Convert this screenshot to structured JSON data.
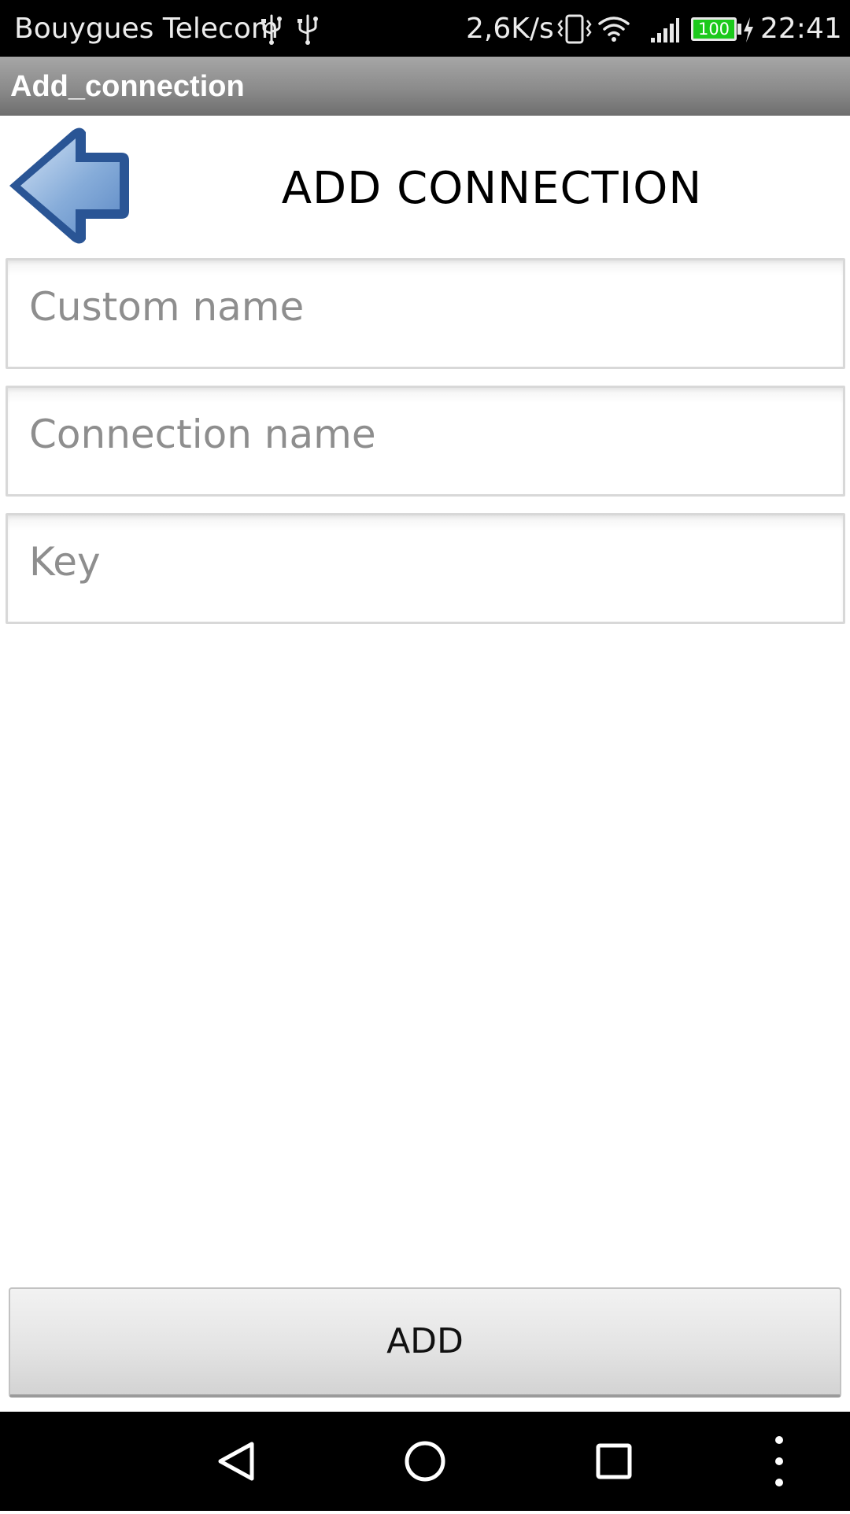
{
  "status_bar": {
    "carrier": "Bouygues Telecom",
    "net_speed": "2,6K/s",
    "battery_level": "100",
    "time": "22:41",
    "icons": [
      "usb-icon",
      "usb-icon",
      "vibrate-icon",
      "wifi-icon",
      "signal-icon",
      "battery-icon",
      "charging-icon"
    ],
    "battery_color": "#1bc91b"
  },
  "app_bar": {
    "title": "Add_connection"
  },
  "header": {
    "back_icon": "arrow-left-icon",
    "heading": "ADD CONNECTION",
    "back_color": "#2a5595"
  },
  "form": {
    "custom_name": {
      "value": "",
      "placeholder": "Custom name"
    },
    "connection_name": {
      "value": "",
      "placeholder": "Connection name"
    },
    "key": {
      "value": "",
      "placeholder": "Key"
    }
  },
  "actions": {
    "add_label": "ADD"
  },
  "nav_bar": {
    "icons": [
      "back-triangle-icon",
      "home-circle-icon",
      "recents-square-icon",
      "more-dots-icon"
    ]
  }
}
